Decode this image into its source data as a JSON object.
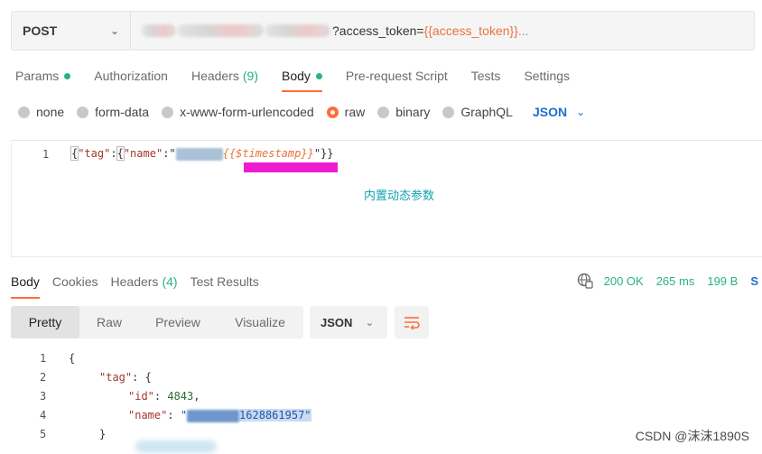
{
  "request": {
    "method": "POST",
    "url_suffix": "?access_token=",
    "url_var": "{{access_token}}",
    "url_ellipsis": " ..."
  },
  "request_tabs": [
    {
      "label": "Params",
      "indicator": "dot"
    },
    {
      "label": "Authorization"
    },
    {
      "label": "Headers",
      "count": "(9)"
    },
    {
      "label": "Body",
      "indicator": "dot",
      "active": true
    },
    {
      "label": "Pre-request Script"
    },
    {
      "label": "Tests"
    },
    {
      "label": "Settings"
    }
  ],
  "body_types": [
    {
      "label": "none"
    },
    {
      "label": "form-data"
    },
    {
      "label": "x-www-form-urlencoded"
    },
    {
      "label": "raw",
      "selected": true
    },
    {
      "label": "binary"
    },
    {
      "label": "GraphQL"
    }
  ],
  "body_format": "JSON",
  "request_editor": {
    "line_number": "1",
    "p_open": "{",
    "k_tag": "\"tag\"",
    "p_colon": ":",
    "p_open2": "{",
    "k_name": "\"name\"",
    "p_colon2": ":",
    "p_quote": "\"",
    "ts_var": "{{$timestamp}}",
    "p_close": "\"}}"
  },
  "annotation": "内置动态参数",
  "response_tabs": [
    {
      "label": "Body",
      "active": true
    },
    {
      "label": "Cookies"
    },
    {
      "label": "Headers",
      "count": "(4)"
    },
    {
      "label": "Test Results"
    }
  ],
  "response_status": {
    "code": "200 OK",
    "time": "265 ms",
    "size": "199 B",
    "save": "S"
  },
  "view_modes": [
    {
      "label": "Pretty",
      "selected": true
    },
    {
      "label": "Raw"
    },
    {
      "label": "Preview"
    },
    {
      "label": "Visualize"
    }
  ],
  "response_format": "JSON",
  "response_body": {
    "lines": [
      "1",
      "2",
      "3",
      "4",
      "5"
    ],
    "l1": "{",
    "l2_key": "\"tag\"",
    "l2_rest": ": {",
    "l3_key": "\"id\"",
    "l3_sep": ": ",
    "l3_val": "4843",
    "l3_comma": ",",
    "l4_key": "\"name\"",
    "l4_sep": ": ",
    "l4_q": "\"",
    "l4_val": "1628861957\"",
    "l5": "}"
  },
  "watermark": "CSDN @沫沫1890S",
  "colors": {
    "accent": "#ff6c37",
    "success": "#26b47f",
    "link": "#1f6fd1",
    "annotation": "#12a2b1",
    "highlight_marker": "#ef1bd1"
  }
}
